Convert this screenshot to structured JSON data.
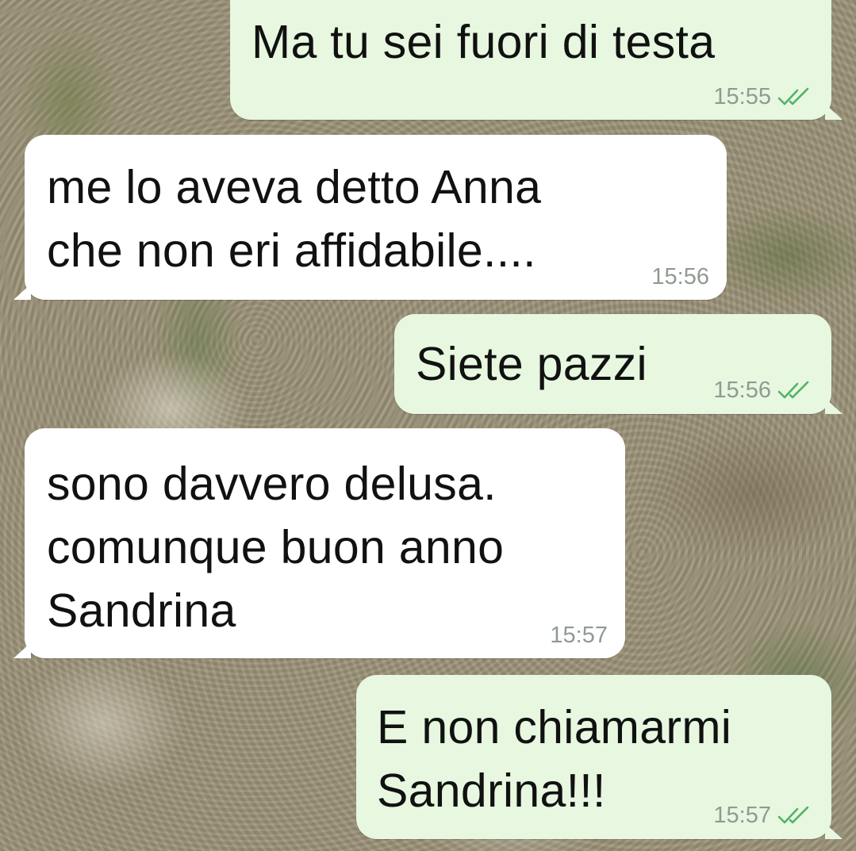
{
  "messages": [
    {
      "direction": "outgoing",
      "text": "Ma tu sei fuori di testa",
      "time": "15:55",
      "status": "read"
    },
    {
      "direction": "incoming",
      "text": "me lo aveva detto Anna\nche non eri affidabile....",
      "time": "15:56"
    },
    {
      "direction": "outgoing",
      "text": "Siete pazzi",
      "time": "15:56",
      "status": "read"
    },
    {
      "direction": "incoming",
      "text": "sono davvero delusa.\ncomunque buon anno\nSandrina",
      "time": "15:57"
    },
    {
      "direction": "outgoing",
      "text": "E non chiamarmi\nSandrina!!!",
      "time": "15:57",
      "status": "read"
    }
  ],
  "colors": {
    "outgoing_bubble": "#e7f7e0",
    "incoming_bubble": "#ffffff",
    "timestamp": "#909a92",
    "read_ticks": "#52b26a"
  },
  "icons": {
    "read_status": "double-check-icon"
  }
}
